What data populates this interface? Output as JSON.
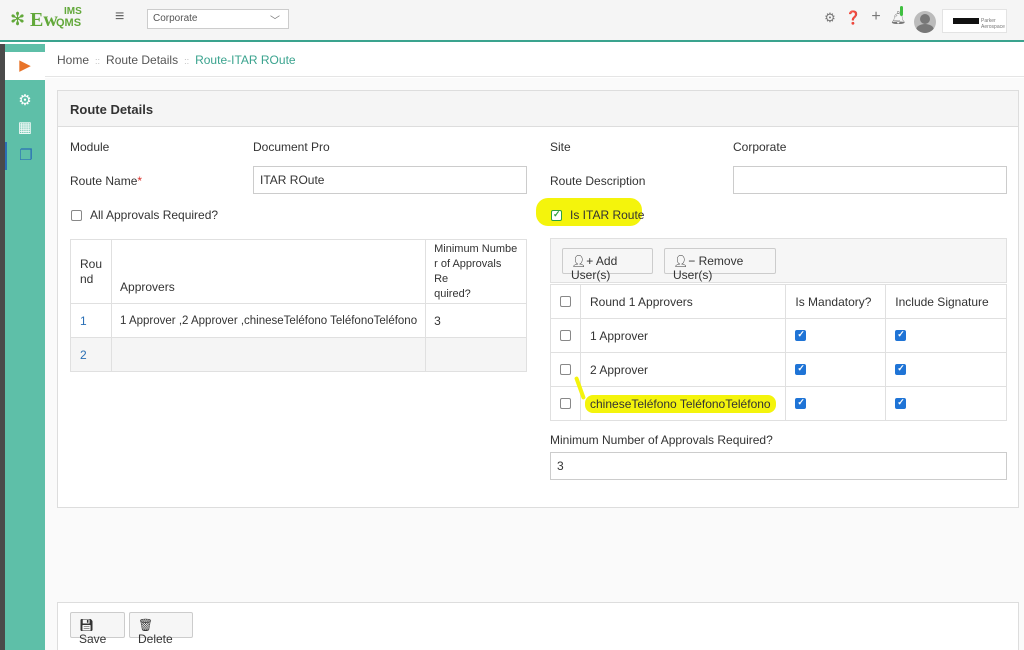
{
  "app": {
    "logo_text": "Ew",
    "logo_ims": "IMS",
    "logo_qms": "QMS",
    "site_selector": "Corporate",
    "brand_text": "Parker Aerospace"
  },
  "breadcrumb": [
    "Home",
    "Route Details",
    "Route-ITAR ROute"
  ],
  "panel": {
    "title": "Route Details"
  },
  "form": {
    "module_label": "Module",
    "module_value": "Document Pro",
    "site_label": "Site",
    "site_value": "Corporate",
    "route_name_label": "Route Name",
    "required_mark": "*",
    "route_name_value": "ITAR ROute",
    "route_desc_label": "Route Description",
    "route_desc_value": "",
    "all_approvals_label": "All Approvals Required?",
    "is_itar_label": "Is ITAR Route"
  },
  "rounds_table": {
    "headers": [
      "Rou\nnd",
      "Approvers",
      "Minimum Numbe r of Approvals Re quired?"
    ],
    "rows": [
      {
        "round": "1",
        "approvers": "1 Approver ,2 Approver ,chineseTeléfono TeléfonoTeléfono",
        "min": "3"
      },
      {
        "round": "2",
        "approvers": "",
        "min": ""
      }
    ]
  },
  "approvers_panel": {
    "add_users": "Add User(s)",
    "remove_users": "Remove User(s)",
    "headers": [
      "Round 1 Approvers",
      "Is Mandatory?",
      "Include Signature"
    ],
    "rows": [
      {
        "name": "1 Approver",
        "mandatory": true,
        "signature": true
      },
      {
        "name": "2 Approver",
        "mandatory": true,
        "signature": true
      },
      {
        "name": "chineseTeléfono TeléfonoTeléfono",
        "mandatory": true,
        "signature": true
      }
    ],
    "min_label": "Minimum Number of Approvals Required?",
    "min_value": "3"
  },
  "footer": {
    "save": "Save",
    "delete": "Delete"
  },
  "colors": {
    "accent": "#3aa38e",
    "sidebar": "#5ebfa8",
    "link": "#2a6fb5",
    "highlight": "#f4f40c"
  }
}
